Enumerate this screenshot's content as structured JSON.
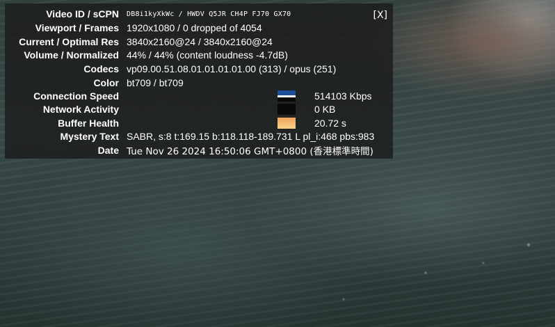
{
  "panel": {
    "close_label": "[X]",
    "rows": [
      {
        "label": "Video ID / sCPN",
        "value": "DB8i1kyXkWc  /  HWDV  Q5JR  CH4P  FJ70  GX70"
      },
      {
        "label": "Viewport / Frames",
        "value": "1920x1080 / 0 dropped of 4054"
      },
      {
        "label": "Current / Optimal Res",
        "value": "3840x2160@24 / 3840x2160@24"
      },
      {
        "label": "Volume / Normalized",
        "value": "44% / 44% (content loudness -4.7dB)"
      },
      {
        "label": "Codecs",
        "value": "vp09.00.51.08.01.01.01.01.00 (313) / opus (251)"
      },
      {
        "label": "Color",
        "value": "bt709 / bt709"
      },
      {
        "label": "Connection Speed",
        "value": "514103 Kbps"
      },
      {
        "label": "Network Activity",
        "value": "0 KB"
      },
      {
        "label": "Buffer Health",
        "value": "20.72 s"
      },
      {
        "label": "Mystery Text",
        "value": "SABR, s:8 t:169.15 b:118.118-189.731 L pl_i:468 pbs:983"
      },
      {
        "label": "Date",
        "value": "Tue Nov 26 2024 16:50:06 GMT+0800 (香港標準時間)"
      }
    ]
  },
  "graph_colors": {
    "connection": [
      "#1f4f9a",
      "#ffffff",
      "#0a0a0a"
    ],
    "network": [
      "#0a0a0a"
    ],
    "buffer": [
      "#f2a25a",
      "#f7d48c"
    ]
  }
}
